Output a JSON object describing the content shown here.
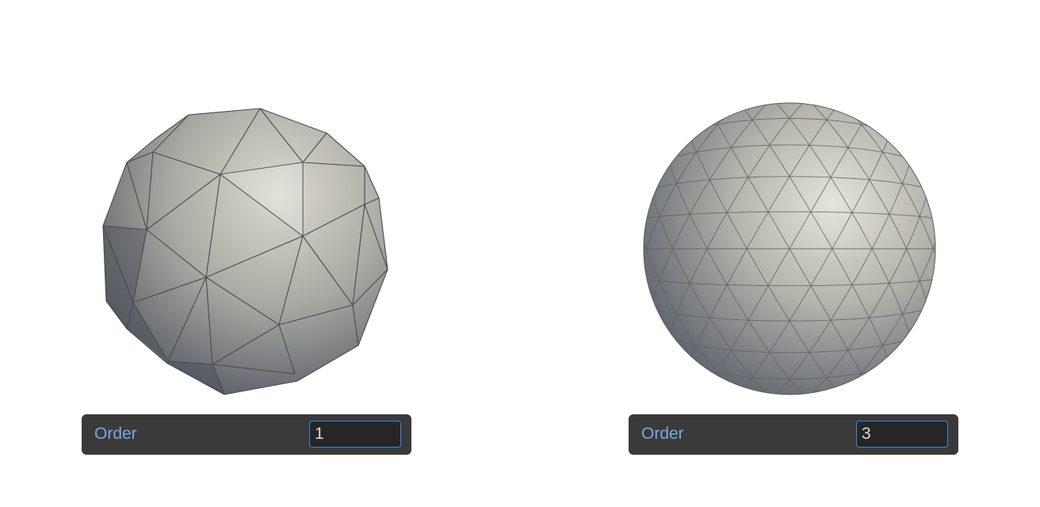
{
  "panels": [
    {
      "order_label": "Order",
      "order_value": "1"
    },
    {
      "order_label": "Order",
      "order_value": "3"
    }
  ],
  "colors": {
    "bar_background": "#3a3a3a",
    "label": "#7aa6e8",
    "input_border": "#3f86e0",
    "mesh_light": "#dcdbd2",
    "mesh_dark": "#50565f",
    "mesh_edge": "#4a4a4a"
  }
}
